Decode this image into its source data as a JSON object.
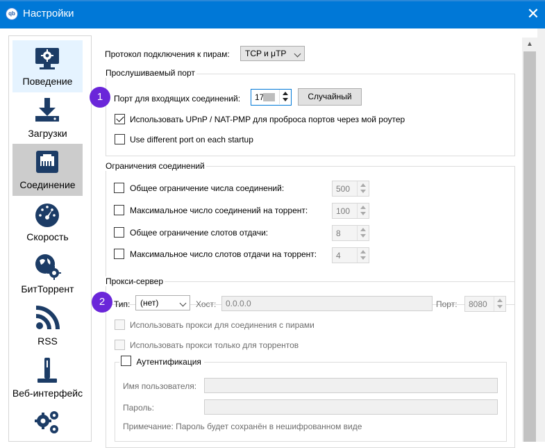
{
  "window": {
    "title": "Настройки",
    "app_icon_text": "qb",
    "close_glyph": "✕"
  },
  "sidebar": {
    "items": [
      {
        "label": "Поведение",
        "icon": "monitor-gear-icon"
      },
      {
        "label": "Загрузки",
        "icon": "download-icon"
      },
      {
        "label": "Соединение",
        "icon": "network-port-icon"
      },
      {
        "label": "Скорость",
        "icon": "speedometer-icon"
      },
      {
        "label": "БитТоррент",
        "icon": "globe-gear-icon"
      },
      {
        "label": "RSS",
        "icon": "rss-icon"
      },
      {
        "label": "Веб-интерфейс",
        "icon": "web-ui-icon"
      },
      {
        "label": "",
        "icon": "gears-icon"
      }
    ],
    "selected": "Соединение"
  },
  "connection": {
    "protocol_label": "Протокол подключения к пирам:",
    "protocol_value": "TCP и μTP",
    "listening": {
      "title": "Прослушиваемый порт",
      "port_label": "Порт для входящих соединений:",
      "port_value": "17",
      "random_button": "Случайный",
      "upnp_label": "Использовать UPnP / NAT-PMP для проброса портов через мой роутер",
      "upnp_checked": true,
      "diff_port_label": "Use different port on each startup",
      "diff_port_checked": false
    },
    "limits": {
      "title": "Ограничения соединений",
      "rows": [
        {
          "label": "Общее ограничение числа соединений:",
          "value": "500"
        },
        {
          "label": "Максимальное число соединений на торрент:",
          "value": "100"
        },
        {
          "label": "Общее ограничение слотов отдачи:",
          "value": "8"
        },
        {
          "label": "Максимальное число слотов отдачи на торрент:",
          "value": "4"
        }
      ]
    },
    "proxy": {
      "title": "Прокси-сервер",
      "type_label": "Тип:",
      "type_value": "(нет)",
      "host_label": "Хост:",
      "host_value": "0.0.0.0",
      "port_label": "Порт:",
      "port_value": "8080",
      "peers_label": "Использовать прокси для соединения с пирами",
      "torrents_only_label": "Использовать прокси только для торрентов",
      "auth_title": "Аутентификация",
      "username_label": "Имя пользователя:",
      "password_label": "Пароль:",
      "note": "Примечание: Пароль будет сохранён в нешифрованном виде"
    }
  },
  "badges": [
    "1",
    "2"
  ],
  "colors": {
    "titlebar": "#0078d7",
    "badge": "#6a26d9",
    "selected": "#cccccc",
    "icon": "#1c3c66"
  }
}
